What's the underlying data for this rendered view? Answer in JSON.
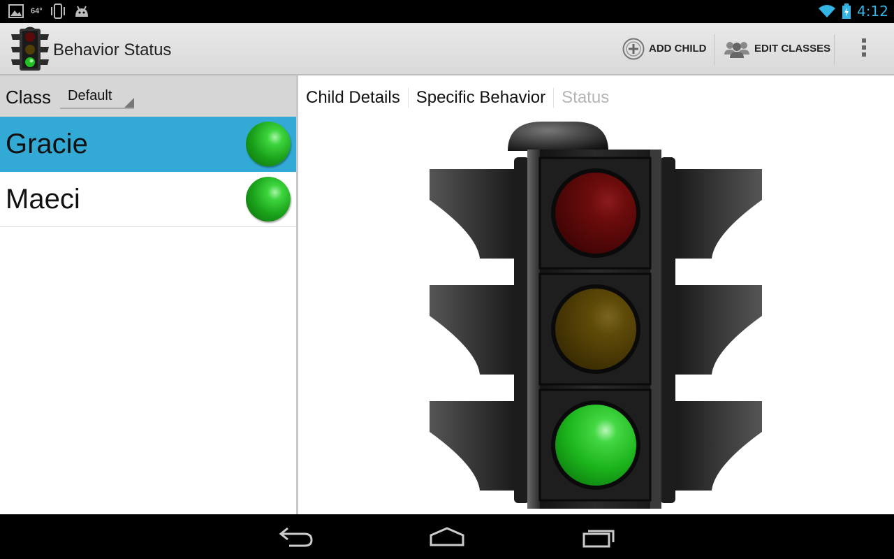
{
  "status_bar": {
    "temperature": "64°",
    "time": "4:12",
    "icons": [
      "gallery-icon",
      "vibrate-icon",
      "android-debug-icon",
      "wifi-icon",
      "battery-charging-icon"
    ]
  },
  "action_bar": {
    "title": "Behavior Status",
    "add_child_label": "ADD CHILD",
    "edit_classes_label": "EDIT CLASSES"
  },
  "left_pane": {
    "class_label": "Class",
    "class_selected": "Default",
    "children": [
      {
        "name": "Gracie",
        "status": "green",
        "selected": true
      },
      {
        "name": "Maeci",
        "status": "green",
        "selected": false
      }
    ]
  },
  "right_pane": {
    "tabs": [
      {
        "label": "Child Details",
        "active": true
      },
      {
        "label": "Specific Behavior",
        "active": true
      },
      {
        "label": "Status",
        "active": false
      }
    ],
    "traffic_light": {
      "active": "green"
    }
  },
  "colors": {
    "accent": "#33b5e5",
    "selected_row": "#33aad6",
    "red_off": "#6b0a0a",
    "yellow_off": "#5e4a06",
    "green_on": "#22c022"
  }
}
